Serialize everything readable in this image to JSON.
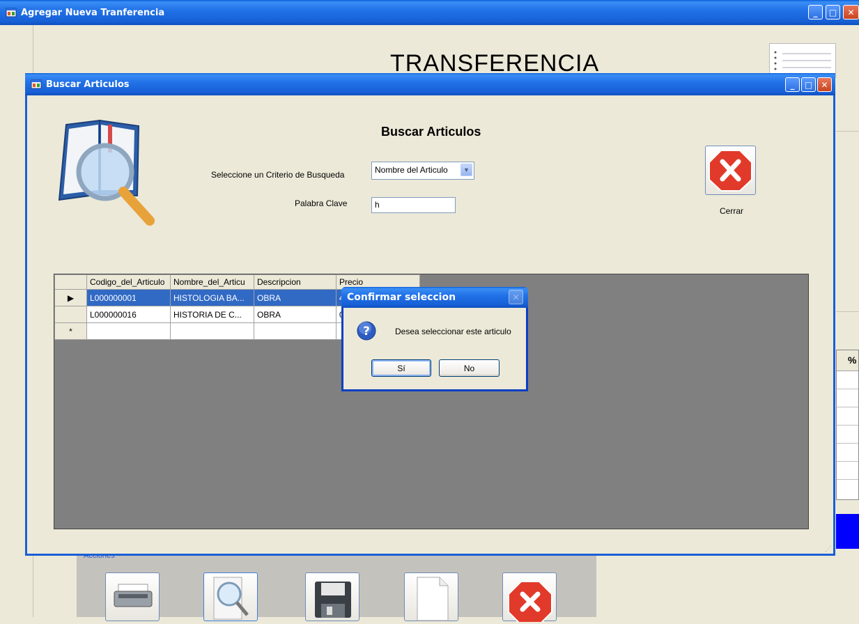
{
  "main_window": {
    "title": "Agregar Nueva Tranferencia",
    "heading": "TRANSFERENCIA",
    "group_label": "Acciones",
    "right_col_header": "%"
  },
  "child_window": {
    "title": "Buscar Articulos",
    "heading": "Buscar Articulos",
    "criterio_label": "Seleccione un Criterio de Busqueda",
    "criterio_value": "Nombre del Articulo",
    "keyword_label": "Palabra Clave",
    "keyword_value": "h",
    "close_label": "Cerrar"
  },
  "grid": {
    "columns": [
      "Codigo_del_Articulo",
      "Nombre_del_Articu",
      "Descripcion",
      "Precio"
    ],
    "rows": [
      {
        "marker": "▶",
        "codigo": "L000000001",
        "nombre": "HISTOLOGIA BA...",
        "descripcion": "OBRA",
        "precio": "4"
      },
      {
        "marker": "",
        "codigo": "L000000016",
        "nombre": "HISTORIA DE C...",
        "descripcion": "OBRA",
        "precio": "0"
      }
    ],
    "new_row_marker": "*"
  },
  "dialog": {
    "title": "Confirmar seleccion",
    "message": "Desea seleccionar este articulo",
    "yes_label": "Sí",
    "no_label": "No"
  },
  "icons": {
    "minimize": "_",
    "maximize": "□",
    "close": "✕"
  },
  "colors": {
    "titlebar": "#2272E8",
    "selection": "#316AC5",
    "grid_bg": "#808080",
    "accent_blue_panel": "#0000FF",
    "close_red": "#E23A2A"
  }
}
